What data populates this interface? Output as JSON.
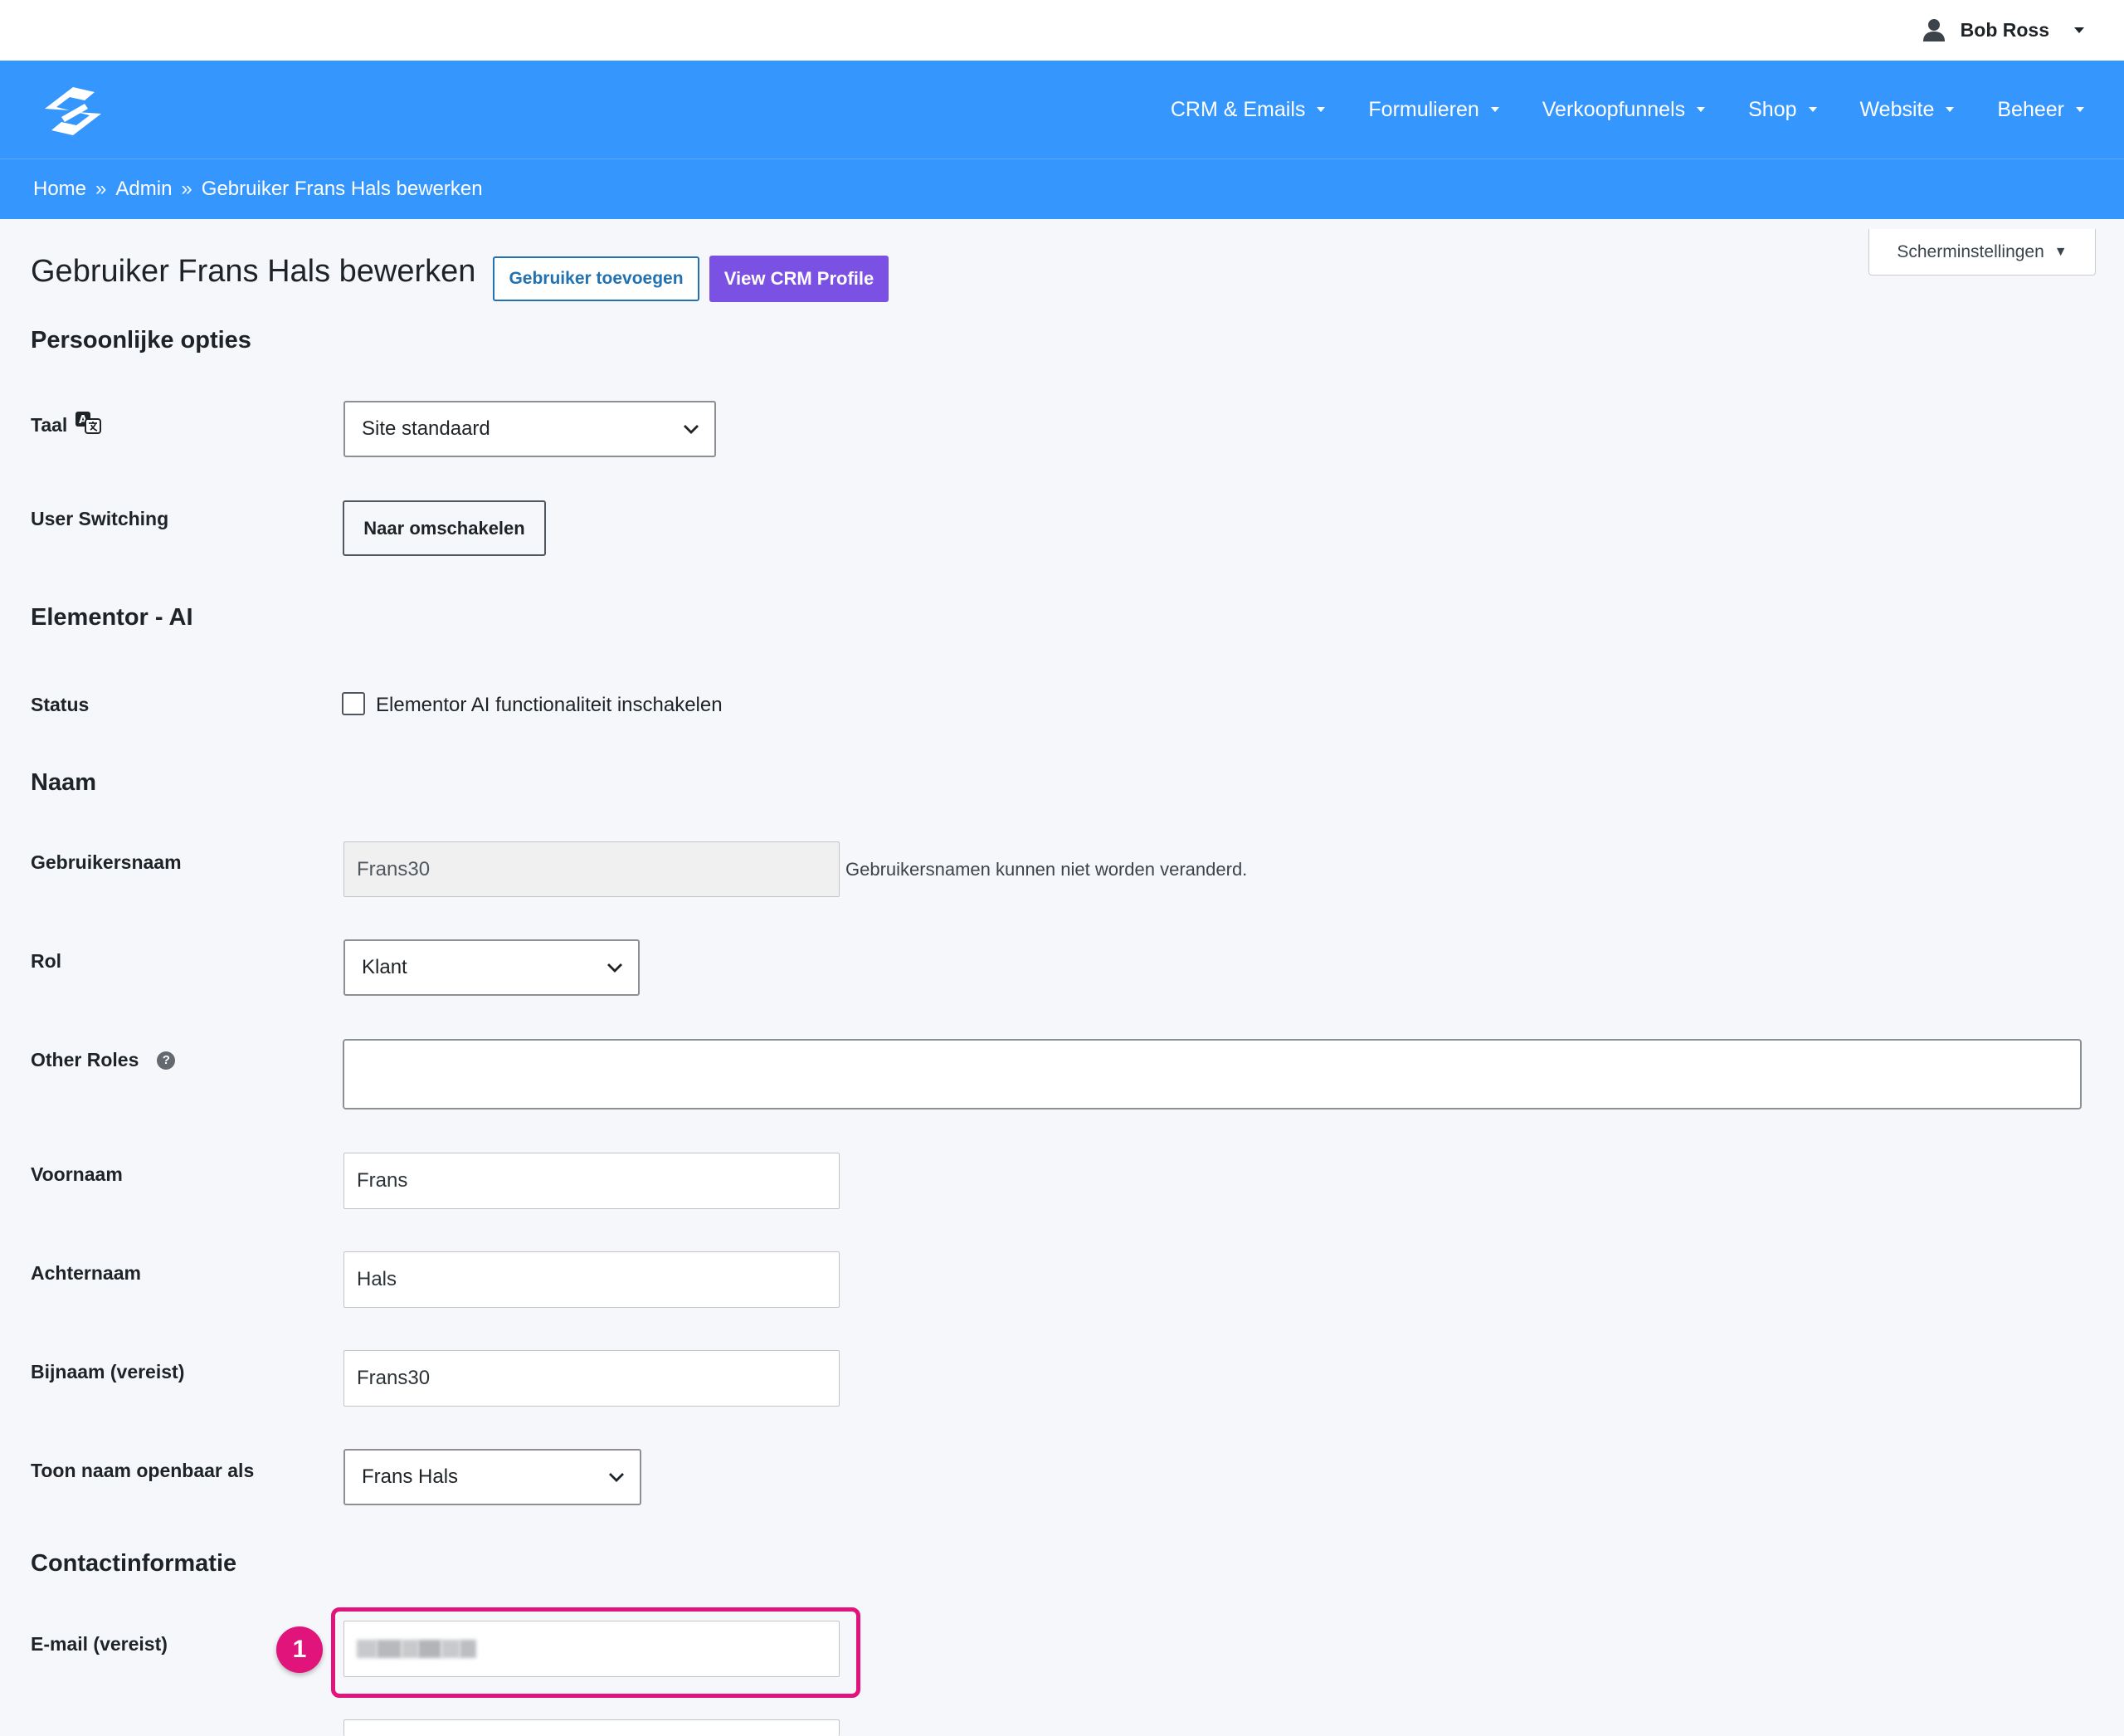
{
  "user_menu": {
    "name": "Bob Ross"
  },
  "nav": {
    "items": [
      {
        "label": "CRM & Emails"
      },
      {
        "label": "Formulieren"
      },
      {
        "label": "Verkoopfunnels"
      },
      {
        "label": "Shop"
      },
      {
        "label": "Website"
      },
      {
        "label": "Beheer"
      }
    ]
  },
  "breadcrumb": {
    "home": "Home",
    "admin": "Admin",
    "current": "Gebruiker Frans Hals bewerken",
    "separator": "»"
  },
  "screen_settings": {
    "label": "Scherminstellingen",
    "arrow": "▼"
  },
  "page": {
    "title": "Gebruiker Frans Hals bewerken",
    "add_user_button": "Gebruiker toevoegen",
    "crm_profile_button": "View CRM Profile"
  },
  "personal": {
    "heading": "Persoonlijke opties",
    "language_label": "Taal",
    "language_value": "Site standaard",
    "user_switching_label": "User Switching",
    "user_switching_button": "Naar omschakelen"
  },
  "elementor": {
    "heading": "Elementor - AI",
    "status_label": "Status",
    "checkbox_label": "Elementor AI functionaliteit inschakelen",
    "checked": false
  },
  "name": {
    "heading": "Naam",
    "username_label": "Gebruikersnaam",
    "username_value": "Frans30",
    "username_note": "Gebruikersnamen kunnen niet worden veranderd.",
    "role_label": "Rol",
    "role_value": "Klant",
    "other_roles_label": "Other Roles",
    "other_roles_value": "",
    "help_glyph": "?",
    "firstname_label": "Voornaam",
    "firstname_value": "Frans",
    "lastname_label": "Achternaam",
    "lastname_value": "Hals",
    "nickname_label": "Bijnaam (vereist)",
    "nickname_value": "Frans30",
    "display_label": "Toon naam openbaar als",
    "display_value": "Frans Hals"
  },
  "contact": {
    "heading": "Contactinformatie",
    "email_label": "E-mail (vereist)",
    "annotation_number": "1"
  },
  "colors": {
    "header_blue": "#3597fd",
    "purple_button": "#7b51e4",
    "highlight_pink": "#e0147a",
    "page_bg": "#f6f7fa"
  },
  "icons": [
    "user-icon",
    "logo-icon",
    "translate-icon",
    "chevron-down-icon",
    "help-icon"
  ]
}
